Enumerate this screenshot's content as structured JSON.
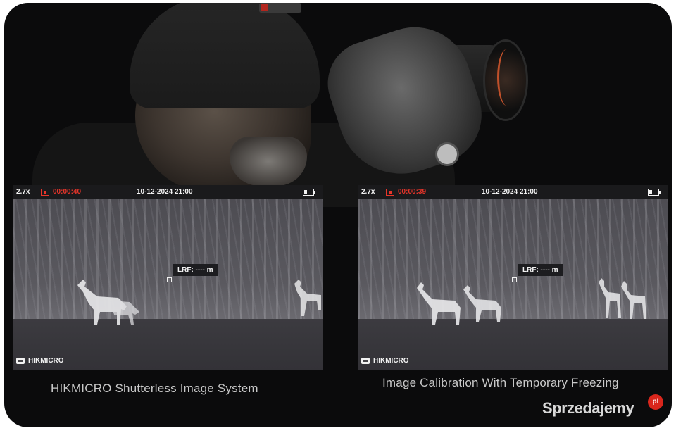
{
  "panels": [
    {
      "zoom": "2.7x",
      "rec_time": "00:00:40",
      "datetime": "10-12-2024 21:00",
      "lrf": "LRF: ---- m",
      "brand": "HIKMICRO",
      "caption": "HIKMICRO Shutterless Image System"
    },
    {
      "zoom": "2.7x",
      "rec_time": "00:00:39",
      "datetime": "10-12-2024 21:00",
      "lrf": "LRF: ---- m",
      "brand": "HIKMICRO",
      "caption": "Image Calibration With Temporary Freezing"
    }
  ],
  "watermark": {
    "text": "Sprzedajemy",
    "badge": "pl"
  },
  "colors": {
    "recording": "#e8352a",
    "hud_text": "#f2f2f2",
    "thermal_bg": "#464549",
    "frame_bg": "#0b0b0c"
  },
  "icons": [
    "record-icon",
    "battery-icon",
    "reticle-icon",
    "hikmicro-logo-icon"
  ]
}
